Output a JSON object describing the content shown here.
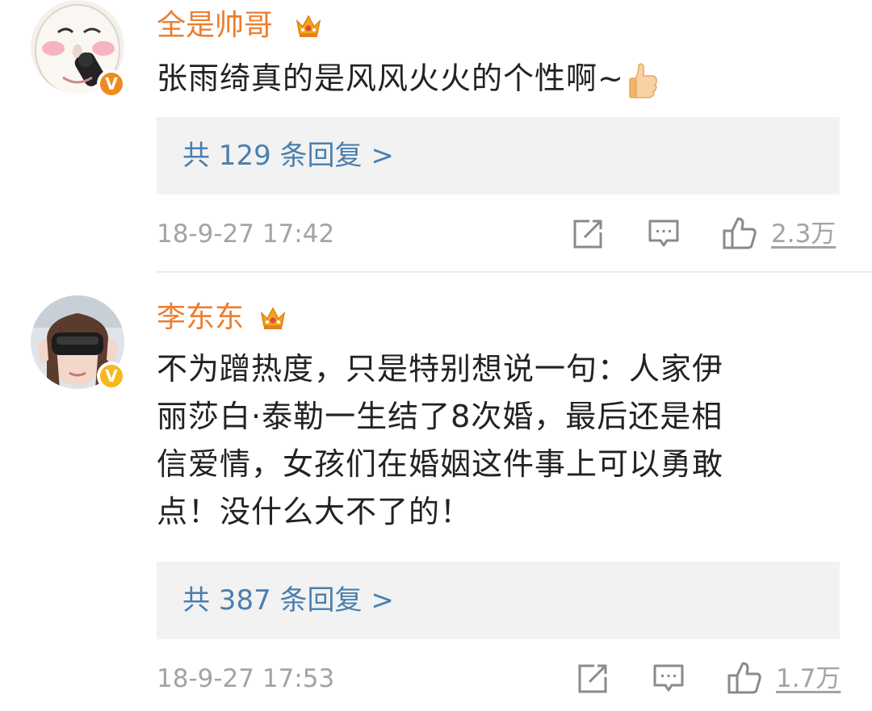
{
  "comments": [
    {
      "username": "全是帅哥",
      "text": "张雨绮真的是风风火火的个性啊~",
      "emoji": "thumbs-up-emoji",
      "replies": "共 129 条回复 >",
      "timestamp": "18-9-27 17:42",
      "likes": "2.3万",
      "badge": "V",
      "badge_color": "#f08a1d"
    },
    {
      "username": "李东东",
      "text_lines": [
        "不为蹭热度，只是特别想说一句：人家伊",
        "丽莎白·泰勒一生结了8次婚，最后还是相",
        "信爱情，女孩们在婚姻这件事上可以勇敢",
        "点！没什么大不了的！"
      ],
      "replies": "共 387 条回复 >",
      "timestamp": "18-9-27 17:53",
      "likes": "1.7万",
      "badge": "V",
      "badge_color": "#f7b81d"
    }
  ],
  "icons": {
    "share": "share-icon",
    "comment": "comment-icon",
    "like": "thumbs-up-icon",
    "crown": "crown-icon"
  },
  "colors": {
    "username": "#ed7d2f",
    "link": "#4a7fae",
    "meta": "#a3a3a3",
    "reply_bg": "#f2f2f2"
  }
}
